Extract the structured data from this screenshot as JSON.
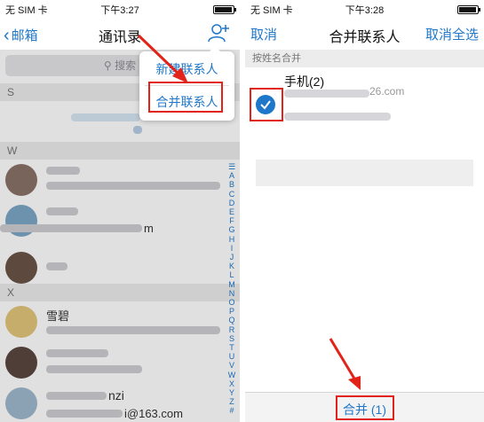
{
  "left_screen": {
    "status": {
      "carrier": "无 SIM 卡",
      "time": "下午3:27"
    },
    "nav": {
      "back_label": "邮箱",
      "back_chevron": "‹",
      "title": "通讯录",
      "right_icon": "person-add-icon"
    },
    "search": {
      "placeholder": "搜索",
      "icon": "search-icon"
    },
    "popup": {
      "items": [
        {
          "label": "新建联系人"
        },
        {
          "label": "合并联系人"
        }
      ]
    },
    "sections": [
      "S",
      "W",
      "X"
    ],
    "rows": [
      {
        "fragment": "m"
      },
      {
        "name": "雪碧"
      },
      {
        "fragment": "nzi"
      },
      {
        "fragment": "i@163.com"
      }
    ],
    "index_letters": [
      "☰",
      "A",
      "B",
      "C",
      "D",
      "E",
      "F",
      "G",
      "H",
      "I",
      "J",
      "K",
      "L",
      "M",
      "N",
      "O",
      "P",
      "Q",
      "R",
      "S",
      "T",
      "U",
      "V",
      "W",
      "X",
      "Y",
      "Z",
      "#"
    ],
    "colors": {
      "accent": "#1f77c9",
      "highlight": "#e2231a"
    }
  },
  "right_screen": {
    "status": {
      "carrier": "无 SIM 卡",
      "time": "下午3:28"
    },
    "nav": {
      "cancel_label": "取消",
      "title": "合并联系人",
      "cancel_all_label": "取消全选"
    },
    "group_header": "按姓名合并",
    "contact": {
      "title": "手机(2)",
      "fragment": "26.com",
      "selected": true
    },
    "bottom": {
      "merge_label": "合并 (1)"
    }
  }
}
